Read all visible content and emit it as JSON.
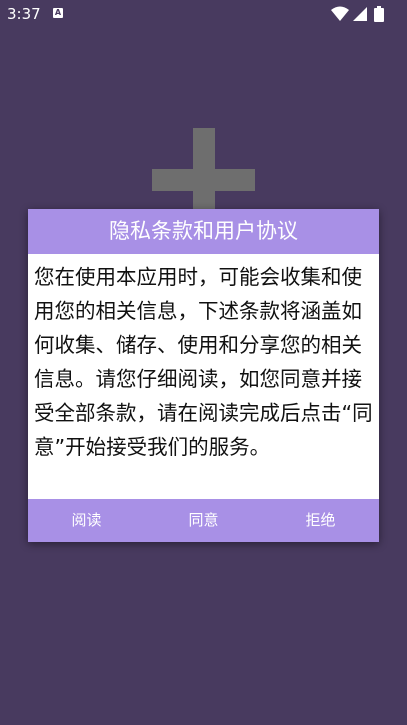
{
  "status_bar": {
    "time": "3:37",
    "notification_icon_letter": "A",
    "icons": [
      "wifi-icon",
      "signal-icon",
      "battery-icon"
    ]
  },
  "background": {
    "icon": "plus-icon"
  },
  "dialog": {
    "title": "隐私条款和用户协议",
    "body": "您在使用本应用时，可能会收集和使用您的相关信息，下述条款将涵盖如何收集、储存、使用和分享您的相关信息。请您仔细阅读，如您同意并接受全部条款，请在阅读完成后点击“同意”开始接受我们的服务。",
    "buttons": {
      "read": "阅读",
      "agree": "同意",
      "reject": "拒绝"
    }
  },
  "colors": {
    "background": "#483a5f",
    "accent": "#a890e6",
    "plus": "#6e6e6e"
  }
}
